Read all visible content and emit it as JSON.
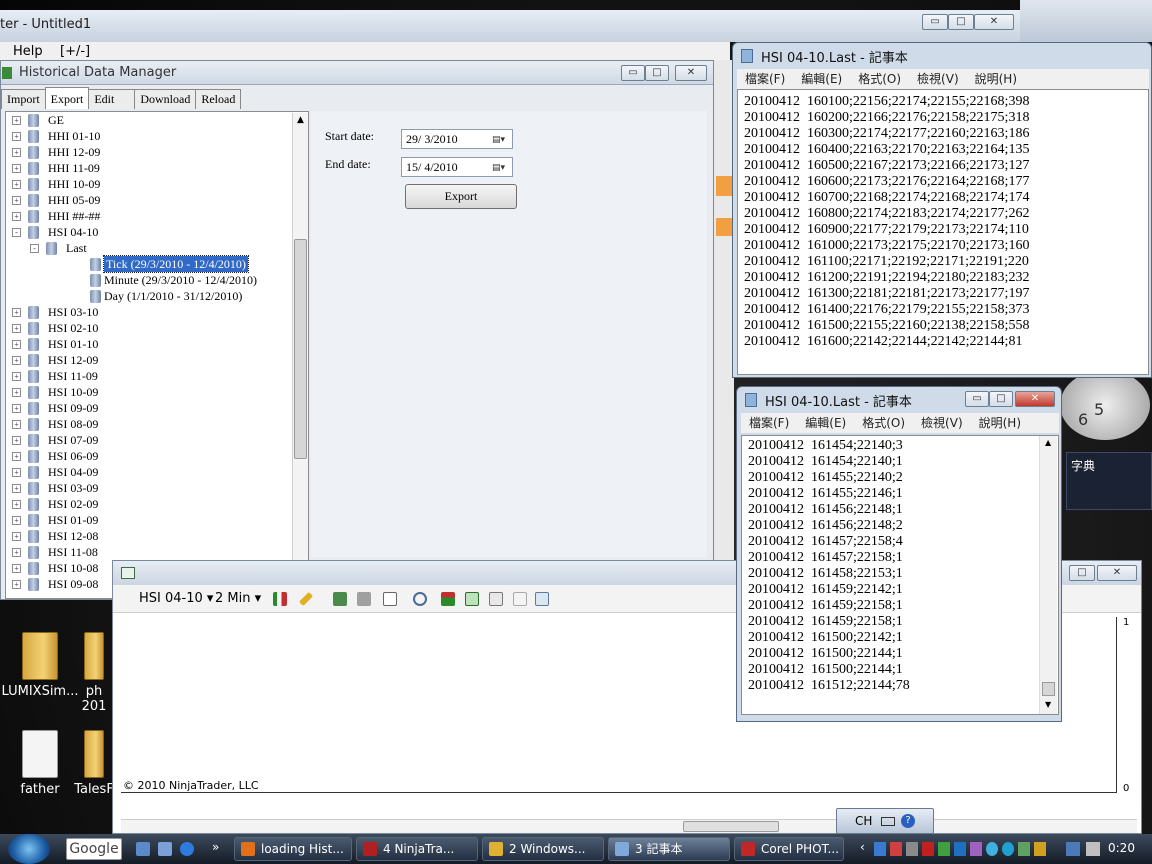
{
  "ninja_main": {
    "title": "ter - Untitled1",
    "menu": [
      "Help",
      "[+/-]"
    ]
  },
  "hdm": {
    "title": "Historical Data Manager",
    "tabs": [
      "Import",
      "Export",
      "Edit",
      "Download",
      "Reload"
    ],
    "tree": [
      {
        "label": "GE",
        "level": 0,
        "expander": "+"
      },
      {
        "label": "HHI 01-10",
        "level": 0,
        "expander": "+"
      },
      {
        "label": "HHI 12-09",
        "level": 0,
        "expander": "+"
      },
      {
        "label": "HHI 11-09",
        "level": 0,
        "expander": "+"
      },
      {
        "label": "HHI 10-09",
        "level": 0,
        "expander": "+"
      },
      {
        "label": "HHI 05-09",
        "level": 0,
        "expander": "+"
      },
      {
        "label": "HHI ##-##",
        "level": 0,
        "expander": "+"
      },
      {
        "label": "HSI 04-10",
        "level": 0,
        "expander": "-"
      },
      {
        "label": "Last",
        "level": 1,
        "expander": "-"
      },
      {
        "label": "Tick (29/3/2010 - 12/4/2010)",
        "level": 2,
        "expander": "",
        "selected": true
      },
      {
        "label": "Minute (29/3/2010 - 12/4/2010)",
        "level": 2,
        "expander": ""
      },
      {
        "label": "Day (1/1/2010 - 31/12/2010)",
        "level": 2,
        "expander": ""
      },
      {
        "label": "HSI 03-10",
        "level": 0,
        "expander": "+"
      },
      {
        "label": "HSI 02-10",
        "level": 0,
        "expander": "+"
      },
      {
        "label": "HSI 01-10",
        "level": 0,
        "expander": "+"
      },
      {
        "label": "HSI 12-09",
        "level": 0,
        "expander": "+"
      },
      {
        "label": "HSI 11-09",
        "level": 0,
        "expander": "+"
      },
      {
        "label": "HSI 10-09",
        "level": 0,
        "expander": "+"
      },
      {
        "label": "HSI 09-09",
        "level": 0,
        "expander": "+"
      },
      {
        "label": "HSI 08-09",
        "level": 0,
        "expander": "+"
      },
      {
        "label": "HSI 07-09",
        "level": 0,
        "expander": "+"
      },
      {
        "label": "HSI 06-09",
        "level": 0,
        "expander": "+"
      },
      {
        "label": "HSI 04-09",
        "level": 0,
        "expander": "+"
      },
      {
        "label": "HSI 03-09",
        "level": 0,
        "expander": "+"
      },
      {
        "label": "HSI 02-09",
        "level": 0,
        "expander": "+"
      },
      {
        "label": "HSI 01-09",
        "level": 0,
        "expander": "+"
      },
      {
        "label": "HSI 12-08",
        "level": 0,
        "expander": "+"
      },
      {
        "label": "HSI 11-08",
        "level": 0,
        "expander": "+"
      },
      {
        "label": "HSI 10-08",
        "level": 0,
        "expander": "+"
      },
      {
        "label": "HSI 09-08",
        "level": 0,
        "expander": "+"
      }
    ],
    "export": {
      "start_label": "Start date:",
      "start_value": "29/ 3/2010",
      "end_label": "End date:",
      "end_value": "15/ 4/2010",
      "button": "Export"
    }
  },
  "notepad1": {
    "title": "HSI 04-10.Last - 記事本",
    "menu": [
      "檔案(F)",
      "編輯(E)",
      "格式(O)",
      "檢視(V)",
      "說明(H)"
    ],
    "lines": [
      "20100412  160100;22156;22174;22155;22168;398",
      "20100412  160200;22166;22176;22158;22175;318",
      "20100412  160300;22174;22177;22160;22163;186",
      "20100412  160400;22163;22170;22163;22164;135",
      "20100412  160500;22167;22173;22166;22173;127",
      "20100412  160600;22173;22176;22164;22168;177",
      "20100412  160700;22168;22174;22168;22174;174",
      "20100412  160800;22174;22183;22174;22177;262",
      "20100412  160900;22177;22179;22173;22174;110",
      "20100412  161000;22173;22175;22170;22173;160",
      "20100412  161100;22171;22192;22171;22191;220",
      "20100412  161200;22191;22194;22180;22183;232",
      "20100412  161300;22181;22181;22173;22177;197",
      "20100412  161400;22176;22179;22155;22158;373",
      "20100412  161500;22155;22160;22138;22158;558",
      "20100412  161600;22142;22144;22142;22144;81"
    ]
  },
  "notepad2": {
    "title": "HSI 04-10.Last - 記事本",
    "menu": [
      "檔案(F)",
      "編輯(E)",
      "格式(O)",
      "檢視(V)",
      "說明(H)"
    ],
    "lines": [
      "20100412  161454;22140;3",
      "20100412  161454;22140;1",
      "20100412  161455;22140;2",
      "20100412  161455;22146;1",
      "20100412  161456;22148;1",
      "20100412  161456;22148;2",
      "20100412  161457;22158;4",
      "20100412  161457;22158;1",
      "20100412  161458;22153;1",
      "20100412  161459;22142;1",
      "20100412  161459;22158;1",
      "20100412  161459;22158;1",
      "20100412  161500;22142;1",
      "20100412  161500;22144;1",
      "20100412  161500;22144;1",
      "20100412  161512;22144;78"
    ]
  },
  "chart": {
    "instrument": "HSI 04-10",
    "interval": "2 Min",
    "copyright": "© 2010 NinjaTrader, LLC",
    "axis_top": "1",
    "axis_bottom": "0"
  },
  "desktop": {
    "icons": [
      {
        "label": "LUMIXSim..."
      },
      {
        "label": "ph\n201"
      },
      {
        "label": "father"
      },
      {
        "label": "TalesF"
      }
    ],
    "dict_label": "字典",
    "clock_digits": [
      "6",
      "5"
    ]
  },
  "langbar": {
    "lang": "CH"
  },
  "taskbar": {
    "search": "Google",
    "items": [
      {
        "label": "loading Hist...",
        "color": "#e0701c"
      },
      {
        "label": "4 NinjaTra...",
        "color": "#b02020"
      },
      {
        "label": "2 Windows...",
        "color": "#e0b030"
      },
      {
        "label": "3 記事本",
        "color": "#7fa9d8",
        "active": true
      },
      {
        "label": "Corel PHOT...",
        "color": "#c02828"
      }
    ],
    "time": "0:20"
  }
}
